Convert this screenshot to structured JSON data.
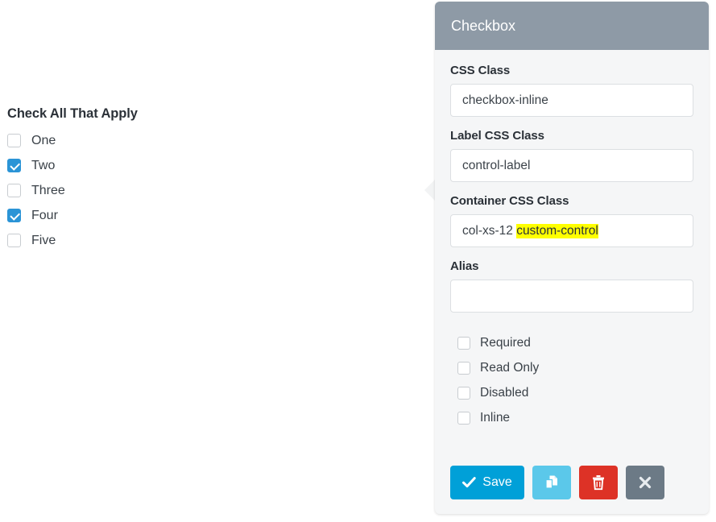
{
  "preview": {
    "group_legend": "Check All That Apply",
    "checkboxes": [
      {
        "label": "One",
        "checked": false
      },
      {
        "label": "Two",
        "checked": true
      },
      {
        "label": "Three",
        "checked": false
      },
      {
        "label": "Four",
        "checked": true
      },
      {
        "label": "Five",
        "checked": false
      }
    ]
  },
  "panel": {
    "title": "Checkbox",
    "fields": [
      {
        "label": "CSS Class",
        "value": "checkbox-inline",
        "selection": ""
      },
      {
        "label": "Label CSS Class",
        "value": "control-label",
        "selection": ""
      },
      {
        "label": "Container CSS Class",
        "value": "col-xs-12 ",
        "selection": "custom-control"
      },
      {
        "label": "Alias",
        "value": "",
        "selection": ""
      }
    ],
    "options": [
      {
        "label": "Required",
        "checked": false
      },
      {
        "label": "Read Only",
        "checked": false
      },
      {
        "label": "Disabled",
        "checked": false
      },
      {
        "label": "Inline",
        "checked": false
      }
    ],
    "buttons": {
      "save": "Save",
      "copy": "",
      "delete": "",
      "close": ""
    }
  },
  "colors": {
    "header_bg": "#8e9aa6",
    "panel_bg": "#f5f6f7",
    "checkbox_checked": "#2b94d6",
    "save_blue": "#00a0d8",
    "copy_blue": "#5bc8ea",
    "delete_red": "#dd3226",
    "close_gray": "#6c7a86",
    "selection_highlight": "#ffff00"
  }
}
